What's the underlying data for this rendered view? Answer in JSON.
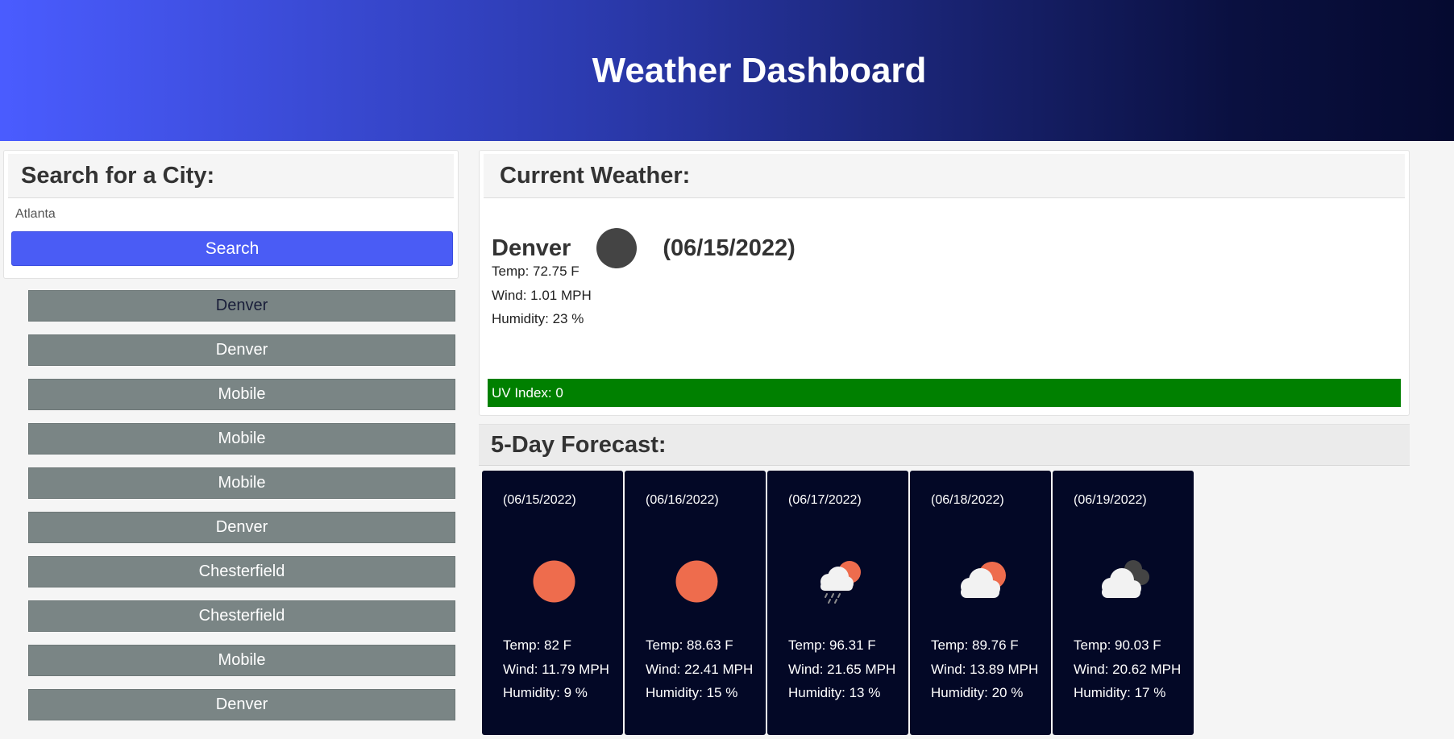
{
  "header": {
    "title": "Weather Dashboard"
  },
  "search": {
    "title": "Search for a City:",
    "input_value": "Atlanta",
    "button_label": "Search"
  },
  "history": [
    "Denver",
    "Denver",
    "Mobile",
    "Mobile",
    "Mobile",
    "Denver",
    "Chesterfield",
    "Chesterfield",
    "Mobile",
    "Denver"
  ],
  "current": {
    "title": "Current Weather:",
    "city": "Denver",
    "date": "(06/15/2022)",
    "icon": "clear-night-icon",
    "temp": "Temp: 72.75 F",
    "wind": "Wind: 1.01 MPH",
    "humidity": "Humidity: 23 %",
    "uv": "UV Index: 0",
    "uv_color": "#008000"
  },
  "forecast": {
    "title": "5-Day Forecast:",
    "days": [
      {
        "date": "(06/15/2022)",
        "icon": "sun-icon",
        "temp": "Temp: 82 F",
        "wind": "Wind: 11.79 MPH",
        "humidity": "Humidity: 9 %"
      },
      {
        "date": "(06/16/2022)",
        "icon": "sun-icon",
        "temp": "Temp: 88.63 F",
        "wind": "Wind: 22.41 MPH",
        "humidity": "Humidity: 15 %"
      },
      {
        "date": "(06/17/2022)",
        "icon": "rain-cloud-sun-icon",
        "temp": "Temp: 96.31 F",
        "wind": "Wind: 21.65 MPH",
        "humidity": "Humidity: 13 %"
      },
      {
        "date": "(06/18/2022)",
        "icon": "cloud-sun-icon",
        "temp": "Temp: 89.76 F",
        "wind": "Wind: 13.89 MPH",
        "humidity": "Humidity: 20 %"
      },
      {
        "date": "(06/19/2022)",
        "icon": "dark-cloud-icon",
        "temp": "Temp: 90.03 F",
        "wind": "Wind: 20.62 MPH",
        "humidity": "Humidity: 17 %"
      }
    ]
  }
}
